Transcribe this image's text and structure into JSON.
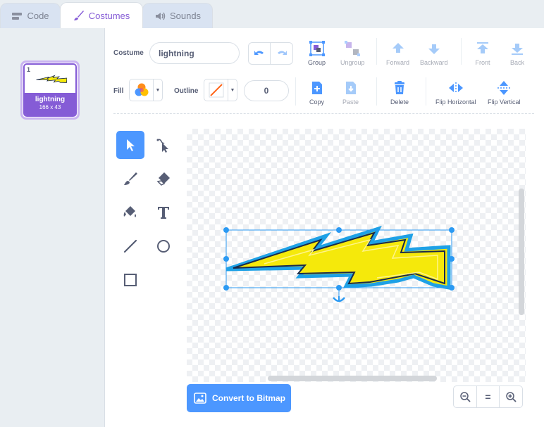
{
  "tabs": [
    {
      "label": "Code",
      "icon": "code-icon"
    },
    {
      "label": "Costumes",
      "icon": "brush-icon"
    },
    {
      "label": "Sounds",
      "icon": "speaker-icon"
    }
  ],
  "costume_list": {
    "items": [
      {
        "number": "1",
        "name": "lightning",
        "size": "166 x 43"
      }
    ]
  },
  "editor": {
    "costume_label": "Costume",
    "costume_name": "lightning",
    "fill_label": "Fill",
    "outline_label": "Outline",
    "stroke_width": "0",
    "toolbar": {
      "group": "Group",
      "ungroup": "Ungroup",
      "forward": "Forward",
      "backward": "Backward",
      "front": "Front",
      "back": "Back",
      "copy": "Copy",
      "paste": "Paste",
      "delete": "Delete",
      "flip_horizontal": "Flip Horizontal",
      "flip_vertical": "Flip Vertical"
    },
    "tools": [
      "select-icon",
      "reshape-icon",
      "brush-icon",
      "eraser-icon",
      "fill-icon",
      "text-icon",
      "line-icon",
      "circle-icon",
      "rectangle-icon"
    ],
    "active_tool": "select",
    "convert_button": "Convert to Bitmap",
    "zoom": {
      "zoom_out": "zoom-out-icon",
      "reset": "=",
      "zoom_in": "zoom-in-icon"
    }
  },
  "colors": {
    "accent": "#855cd6",
    "primary_blue": "#4c97ff",
    "lightning_fill": "#f5e90b",
    "lightning_outline": "#1ea1e6",
    "lightning_inner_stroke": "#1a2a4a",
    "selection": "#2b9af3"
  }
}
